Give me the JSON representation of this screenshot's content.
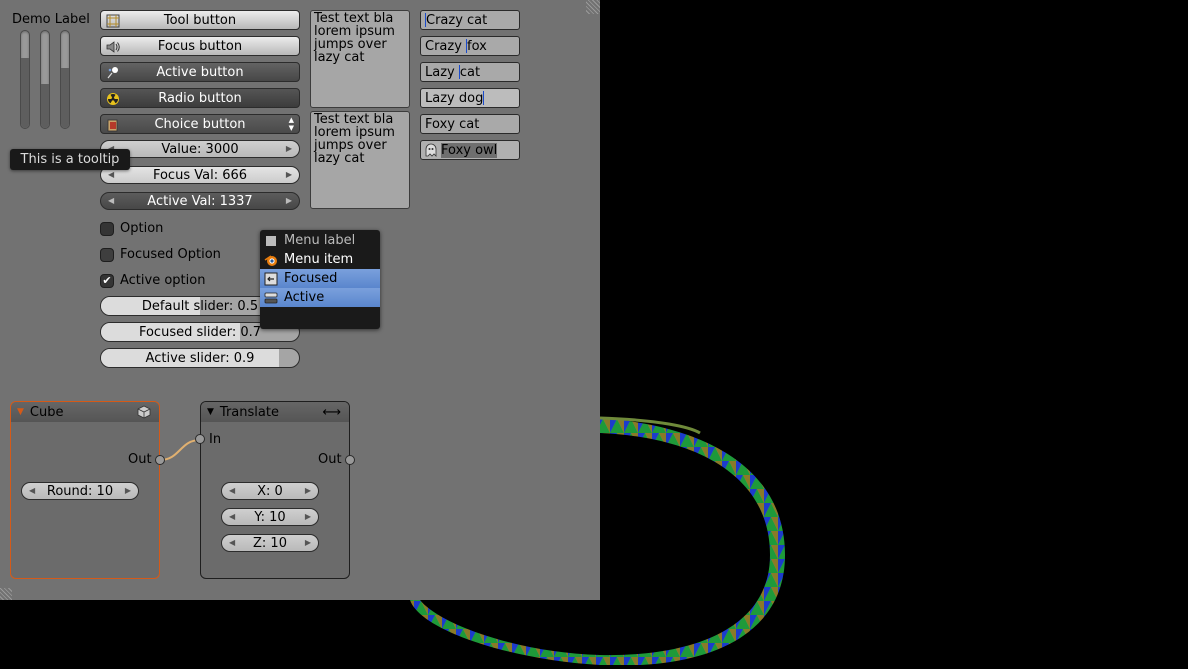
{
  "demo_label": "Demo Label",
  "vsliders": [
    0.72,
    0.45,
    0.62
  ],
  "buttons": {
    "tool": {
      "label": "Tool button",
      "icon": "grid-icon"
    },
    "focus": {
      "label": "Focus button",
      "icon": "speaker-icon"
    },
    "active": {
      "label": "Active button",
      "icon": "pin-icon"
    },
    "radio": {
      "label": "Radio button",
      "icon": "radiation-icon"
    },
    "choice": {
      "label": "Choice button",
      "icon": "book-icon"
    }
  },
  "numbers": {
    "value": "Value: 3000",
    "focus_val": "Focus Val: 666",
    "active_val": "Active Val: 1337"
  },
  "options": {
    "option": "Option",
    "focused": "Focused Option",
    "active": "Active option",
    "active_checked": true
  },
  "sliders": [
    {
      "label": "Default slider: 0.5",
      "value": 0.5
    },
    {
      "label": "Focused slider: 0.7",
      "value": 0.7
    },
    {
      "label": "Active slider: 0.9",
      "value": 0.9
    }
  ],
  "textareas": [
    "Test text bla\nlorem ipsum\njumps over\nlazy cat",
    "Test text bla\nlorem ipsum\njumps over\nlazy cat"
  ],
  "textboxes": {
    "crazy_cat": "Crazy cat",
    "crazy_fox_a": "Crazy ",
    "crazy_fox_b": "fox",
    "lazy_cat_a": "Lazy ",
    "lazy_cat_b": "cat",
    "lazy_dog": "Lazy dog",
    "foxy_cat": "Foxy cat",
    "foxy_owl": "Foxy owl"
  },
  "tooltip": "This is a tooltip",
  "menu": {
    "label": "Menu label",
    "item": "Menu item",
    "focused": "Focused",
    "active": "Active"
  },
  "nodes": {
    "cube": {
      "title": "Cube",
      "out": "Out",
      "round": "Round: 10"
    },
    "translate": {
      "title": "Translate",
      "in": "In",
      "out": "Out",
      "x": "X: 0",
      "y": "Y: 10",
      "z": "Z: 10"
    }
  },
  "colors": {
    "panel": "#727272",
    "accent": "#5a86cd",
    "node_selected": "#d55a18",
    "link": "#e0b070"
  }
}
